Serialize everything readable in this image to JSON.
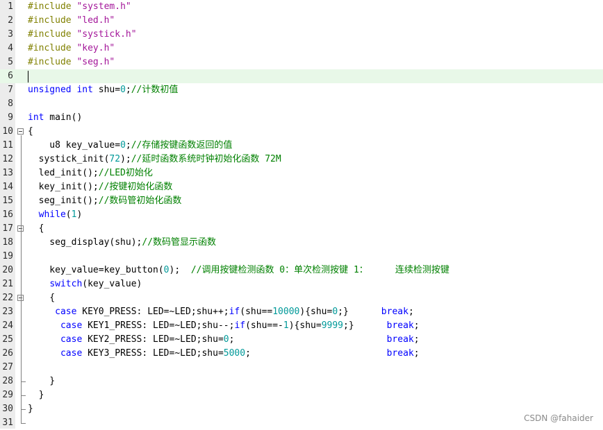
{
  "lines": [
    {
      "n": "1",
      "tokens": [
        {
          "t": "pre",
          "v": "#include "
        },
        {
          "t": "str",
          "v": "\"system.h\""
        }
      ]
    },
    {
      "n": "2",
      "tokens": [
        {
          "t": "pre",
          "v": "#include "
        },
        {
          "t": "str",
          "v": "\"led.h\""
        }
      ]
    },
    {
      "n": "3",
      "tokens": [
        {
          "t": "pre",
          "v": "#include "
        },
        {
          "t": "str",
          "v": "\"systick.h\""
        }
      ]
    },
    {
      "n": "4",
      "tokens": [
        {
          "t": "pre",
          "v": "#include "
        },
        {
          "t": "str",
          "v": "\"key.h\""
        }
      ]
    },
    {
      "n": "5",
      "tokens": [
        {
          "t": "pre",
          "v": "#include "
        },
        {
          "t": "str",
          "v": "\"seg.h\""
        }
      ]
    },
    {
      "n": "6",
      "tokens": []
    },
    {
      "n": "7",
      "tokens": [
        {
          "t": "kw",
          "v": "unsigned"
        },
        {
          "t": "norm",
          "v": " "
        },
        {
          "t": "kw",
          "v": "int"
        },
        {
          "t": "norm",
          "v": " shu="
        },
        {
          "t": "num",
          "v": "0"
        },
        {
          "t": "norm",
          "v": ";"
        },
        {
          "t": "cmt",
          "v": "//计数初值"
        }
      ]
    },
    {
      "n": "8",
      "tokens": []
    },
    {
      "n": "9",
      "tokens": [
        {
          "t": "kw",
          "v": "int"
        },
        {
          "t": "norm",
          "v": " main()"
        }
      ]
    },
    {
      "n": "10",
      "tokens": [
        {
          "t": "norm",
          "v": "{"
        }
      ]
    },
    {
      "n": "11",
      "tokens": [
        {
          "t": "norm",
          "v": "    u8 key_value="
        },
        {
          "t": "num",
          "v": "0"
        },
        {
          "t": "norm",
          "v": ";"
        },
        {
          "t": "cmt",
          "v": "//存储按键函数返回的值"
        }
      ]
    },
    {
      "n": "12",
      "tokens": [
        {
          "t": "norm",
          "v": "  systick_init("
        },
        {
          "t": "num",
          "v": "72"
        },
        {
          "t": "norm",
          "v": ");"
        },
        {
          "t": "cmt",
          "v": "//延时函数系统时钟初始化函数 72M"
        }
      ]
    },
    {
      "n": "13",
      "tokens": [
        {
          "t": "norm",
          "v": "  led_init();"
        },
        {
          "t": "cmt",
          "v": "//LED初始化"
        }
      ]
    },
    {
      "n": "14",
      "tokens": [
        {
          "t": "norm",
          "v": "  key_init();"
        },
        {
          "t": "cmt",
          "v": "//按键初始化函数"
        }
      ]
    },
    {
      "n": "15",
      "tokens": [
        {
          "t": "norm",
          "v": "  seg_init();"
        },
        {
          "t": "cmt",
          "v": "//数码管初始化函数"
        }
      ]
    },
    {
      "n": "16",
      "tokens": [
        {
          "t": "norm",
          "v": "  "
        },
        {
          "t": "kw",
          "v": "while"
        },
        {
          "t": "norm",
          "v": "("
        },
        {
          "t": "num",
          "v": "1"
        },
        {
          "t": "norm",
          "v": ")"
        }
      ]
    },
    {
      "n": "17",
      "tokens": [
        {
          "t": "norm",
          "v": "  {"
        }
      ]
    },
    {
      "n": "18",
      "tokens": [
        {
          "t": "norm",
          "v": "    seg_display(shu);"
        },
        {
          "t": "cmt",
          "v": "//数码管显示函数"
        }
      ]
    },
    {
      "n": "19",
      "tokens": []
    },
    {
      "n": "20",
      "tokens": [
        {
          "t": "norm",
          "v": "    key_value=key_button("
        },
        {
          "t": "num",
          "v": "0"
        },
        {
          "t": "norm",
          "v": ");  "
        },
        {
          "t": "cmt",
          "v": "//调用按键检测函数 0：单次检测按键 1：     连续检测按键"
        }
      ]
    },
    {
      "n": "21",
      "tokens": [
        {
          "t": "norm",
          "v": "    "
        },
        {
          "t": "kw",
          "v": "switch"
        },
        {
          "t": "norm",
          "v": "(key_value)"
        }
      ]
    },
    {
      "n": "22",
      "tokens": [
        {
          "t": "norm",
          "v": "    {"
        }
      ]
    },
    {
      "n": "23",
      "tokens": [
        {
          "t": "norm",
          "v": "     "
        },
        {
          "t": "kw",
          "v": "case"
        },
        {
          "t": "norm",
          "v": " KEY0_PRESS: LED=~LED;shu++;"
        },
        {
          "t": "kw",
          "v": "if"
        },
        {
          "t": "norm",
          "v": "(shu=="
        },
        {
          "t": "num",
          "v": "10000"
        },
        {
          "t": "norm",
          "v": "){shu="
        },
        {
          "t": "num",
          "v": "0"
        },
        {
          "t": "norm",
          "v": ";}      "
        },
        {
          "t": "kw",
          "v": "break"
        },
        {
          "t": "norm",
          "v": ";"
        }
      ]
    },
    {
      "n": "24",
      "tokens": [
        {
          "t": "norm",
          "v": "      "
        },
        {
          "t": "kw",
          "v": "case"
        },
        {
          "t": "norm",
          "v": " KEY1_PRESS: LED=~LED;shu--;"
        },
        {
          "t": "kw",
          "v": "if"
        },
        {
          "t": "norm",
          "v": "(shu==-"
        },
        {
          "t": "num",
          "v": "1"
        },
        {
          "t": "norm",
          "v": "){shu="
        },
        {
          "t": "num",
          "v": "9999"
        },
        {
          "t": "norm",
          "v": ";}      "
        },
        {
          "t": "kw",
          "v": "break"
        },
        {
          "t": "norm",
          "v": ";"
        }
      ]
    },
    {
      "n": "25",
      "tokens": [
        {
          "t": "norm",
          "v": "      "
        },
        {
          "t": "kw",
          "v": "case"
        },
        {
          "t": "norm",
          "v": " KEY2_PRESS: LED=~LED;shu="
        },
        {
          "t": "num",
          "v": "0"
        },
        {
          "t": "norm",
          "v": ";                            "
        },
        {
          "t": "kw",
          "v": "break"
        },
        {
          "t": "norm",
          "v": ";"
        }
      ]
    },
    {
      "n": "26",
      "tokens": [
        {
          "t": "norm",
          "v": "      "
        },
        {
          "t": "kw",
          "v": "case"
        },
        {
          "t": "norm",
          "v": " KEY3_PRESS: LED=~LED;shu="
        },
        {
          "t": "num",
          "v": "5000"
        },
        {
          "t": "norm",
          "v": ";                         "
        },
        {
          "t": "kw",
          "v": "break"
        },
        {
          "t": "norm",
          "v": ";"
        }
      ]
    },
    {
      "n": "27",
      "tokens": []
    },
    {
      "n": "28",
      "tokens": [
        {
          "t": "norm",
          "v": "    }"
        }
      ]
    },
    {
      "n": "29",
      "tokens": [
        {
          "t": "norm",
          "v": "  }"
        }
      ]
    },
    {
      "n": "30",
      "tokens": [
        {
          "t": "norm",
          "v": "}"
        }
      ]
    },
    {
      "n": "31",
      "tokens": []
    }
  ],
  "current_line": "6",
  "fold_markers": [
    "10",
    "17",
    "22"
  ],
  "watermark": "CSDN @fahaider",
  "colors": {
    "preprocessor": "#808000",
    "string": "#a31599",
    "keyword": "#0000ff",
    "number": "#009999",
    "comment": "#008000",
    "current_line_bg": "#e8f8e8",
    "gutter_bg": "#ececec"
  }
}
